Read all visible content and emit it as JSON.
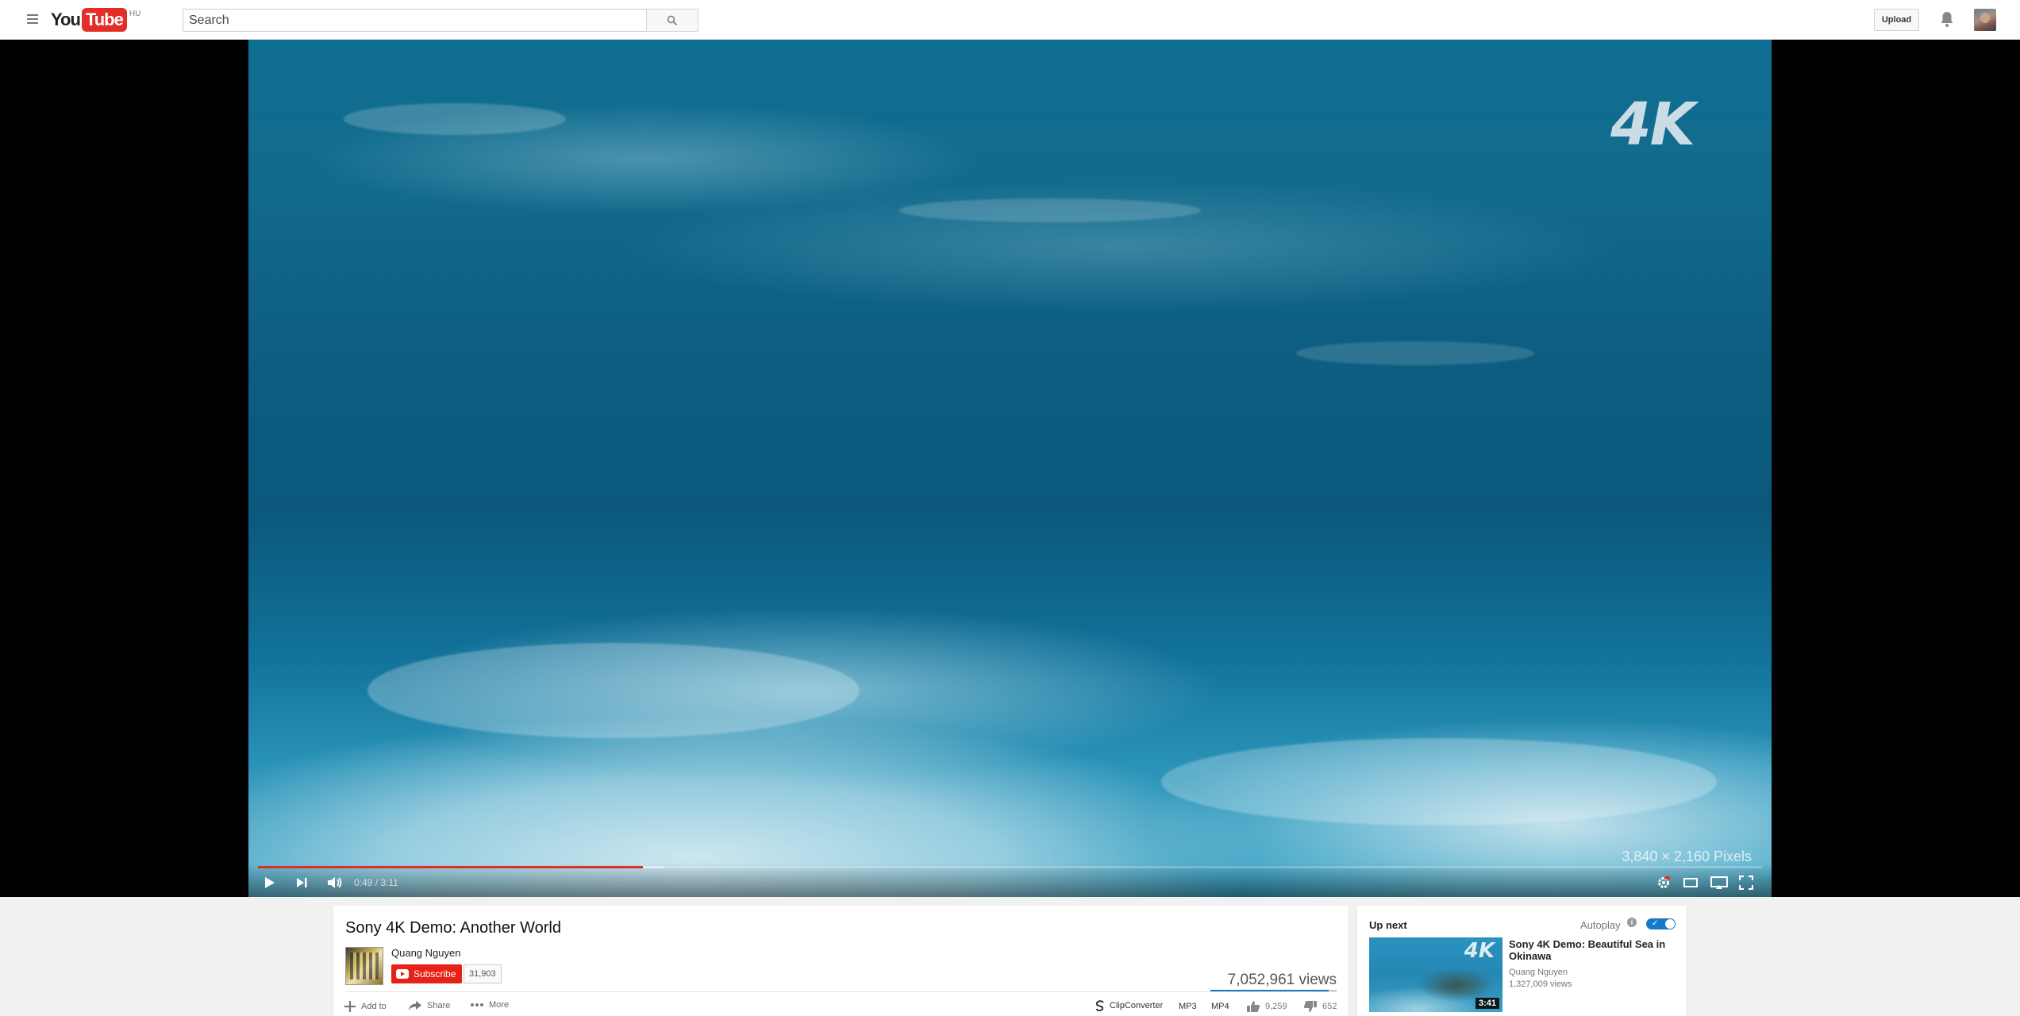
{
  "masthead": {
    "logo": {
      "you": "You",
      "tube": "Tube",
      "country": "HU"
    },
    "search": {
      "placeholder": "Search"
    },
    "upload_label": "Upload"
  },
  "player": {
    "overlay_badge": "4K",
    "resolution_caption": "3,840 × 2,160 Pixels",
    "current_time": "0:49",
    "duration": "3:11",
    "time_display": "0:49 / 3:11",
    "progress_fraction": 0.256,
    "buffered_fraction": 0.27
  },
  "video": {
    "title": "Sony 4K Demo: Another World",
    "channel": "Quang Nguyen",
    "subscribe_label": "Subscribe",
    "subscriber_count": "31,903",
    "views": "7,052,961 views",
    "like_fraction": 0.934,
    "actions": {
      "add_to": "Add to",
      "share": "Share",
      "more": "More",
      "clipconverter": "ClipConverter",
      "mp3": "MP3",
      "mp4": "MP4",
      "likes": "9,259",
      "dislikes": "652"
    }
  },
  "sidebar": {
    "up_next": "Up next",
    "autoplay": "Autoplay",
    "next_video": {
      "title": "Sony 4K Demo: Beautiful Sea in Okinawa",
      "channel": "Quang Nguyen",
      "views": "1,327,009 views",
      "duration": "3:41",
      "thumb_badge": "4K"
    }
  },
  "colors": {
    "brand_red": "#e52d27",
    "subscribe_red": "#e62117",
    "accent_blue": "#167ac6"
  }
}
